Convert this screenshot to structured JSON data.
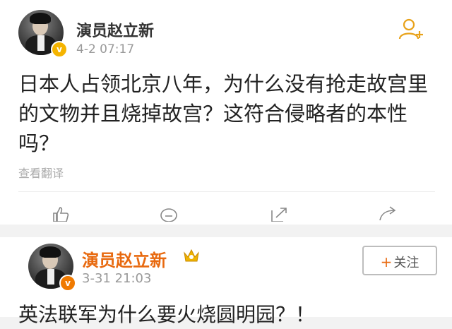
{
  "post1": {
    "author": "演员赵立新",
    "timestamp": "4-2 07:17",
    "verified_badge": "v",
    "text": "日本人占领北京八年，为什么没有抢走故宫里的文物并且烧掉故宫？这符合侵略者的本性吗？",
    "translate_label": "查看翻译",
    "follow_icon": "add-user-icon",
    "actions": [
      "like-icon",
      "comment-icon",
      "repost-icon",
      "share-icon"
    ]
  },
  "post2": {
    "author": "演员赵立新",
    "timestamp": "3-31 21:03",
    "verified_badge": "v",
    "follow_label": "关注",
    "follow_plus": "+",
    "text": "英法联军为什么要火烧圆明园？！"
  },
  "colors": {
    "accent_orange": "#e86a10",
    "badge_gold": "#f5b400",
    "muted_text": "#999999"
  }
}
